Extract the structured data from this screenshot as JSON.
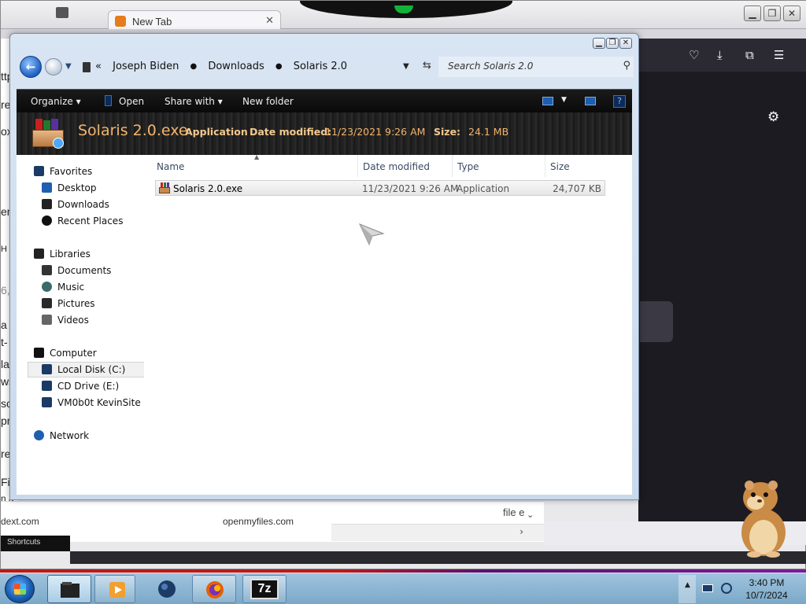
{
  "browser": {
    "tab_title": "New Tab",
    "tab_close": "✕",
    "window_buttons": [
      "▁",
      "❐",
      "✕"
    ],
    "toolbar_icons": [
      "pocket-icon",
      "download-icon",
      "extensions-icon",
      "menu-icon"
    ],
    "left_page_fragments": [
      "ttp",
      "re",
      "ox",
      "en",
      "H",
      "6,",
      "a",
      "t-",
      "la",
      "ws",
      "so",
      "pr",
      "re",
      "Fi",
      "n a"
    ],
    "bottom_links": [
      "dext.com",
      "openmyfiles.com"
    ],
    "bottom_file_text": "file e",
    "shortcuts_label": "Shortcuts"
  },
  "explorer": {
    "caption_buttons": [
      "▁",
      "❐",
      "✕"
    ],
    "breadcrumb": [
      "Joseph Biden",
      "Downloads",
      "Solaris 2.0"
    ],
    "breadcrumb_prefix": "«",
    "search_placeholder": "Search Solaris 2.0",
    "commands": {
      "organize": "Organize ▾",
      "open": "Open",
      "share_with": "Share with ▾",
      "new_folder": "New folder"
    },
    "details": {
      "file_name": "Solaris 2.0.exe",
      "type": "Application",
      "date_label": "Date modified:",
      "date_value": "11/23/2021 9:26 AM",
      "size_label": "Size:",
      "size_value": "24.1 MB"
    },
    "nav_pane": {
      "favorites": "Favorites",
      "desktop": "Desktop",
      "downloads": "Downloads",
      "recent_places": "Recent Places",
      "libraries": "Libraries",
      "documents": "Documents",
      "music": "Music",
      "pictures": "Pictures",
      "videos": "Videos",
      "computer": "Computer",
      "local_disk": "Local Disk (C:)",
      "cd_drive": "CD Drive (E:)",
      "share": "VM0b0t KevinSite",
      "network": "Network"
    },
    "columns": {
      "name": "Name",
      "date_modified": "Date modified",
      "type": "Type",
      "size": "Size"
    },
    "files": [
      {
        "name": "Solaris 2.0.exe",
        "date_modified": "11/23/2021 9:26 AM",
        "type": "Application",
        "size": "24,707 KB"
      }
    ]
  },
  "taskbar": {
    "apps": [
      "file-explorer-icon",
      "media-player-icon",
      "network-globe-icon",
      "firefox-icon",
      "7zip-icon"
    ],
    "seven_zip_label": "7z",
    "tray_arrow": "▲",
    "clock_time": "3:40 PM",
    "clock_date": "10/7/2024"
  },
  "colors": {
    "accent_orange": "#f3b56a",
    "command_bar": "#111111",
    "taskbar": "#8fb8d6"
  }
}
